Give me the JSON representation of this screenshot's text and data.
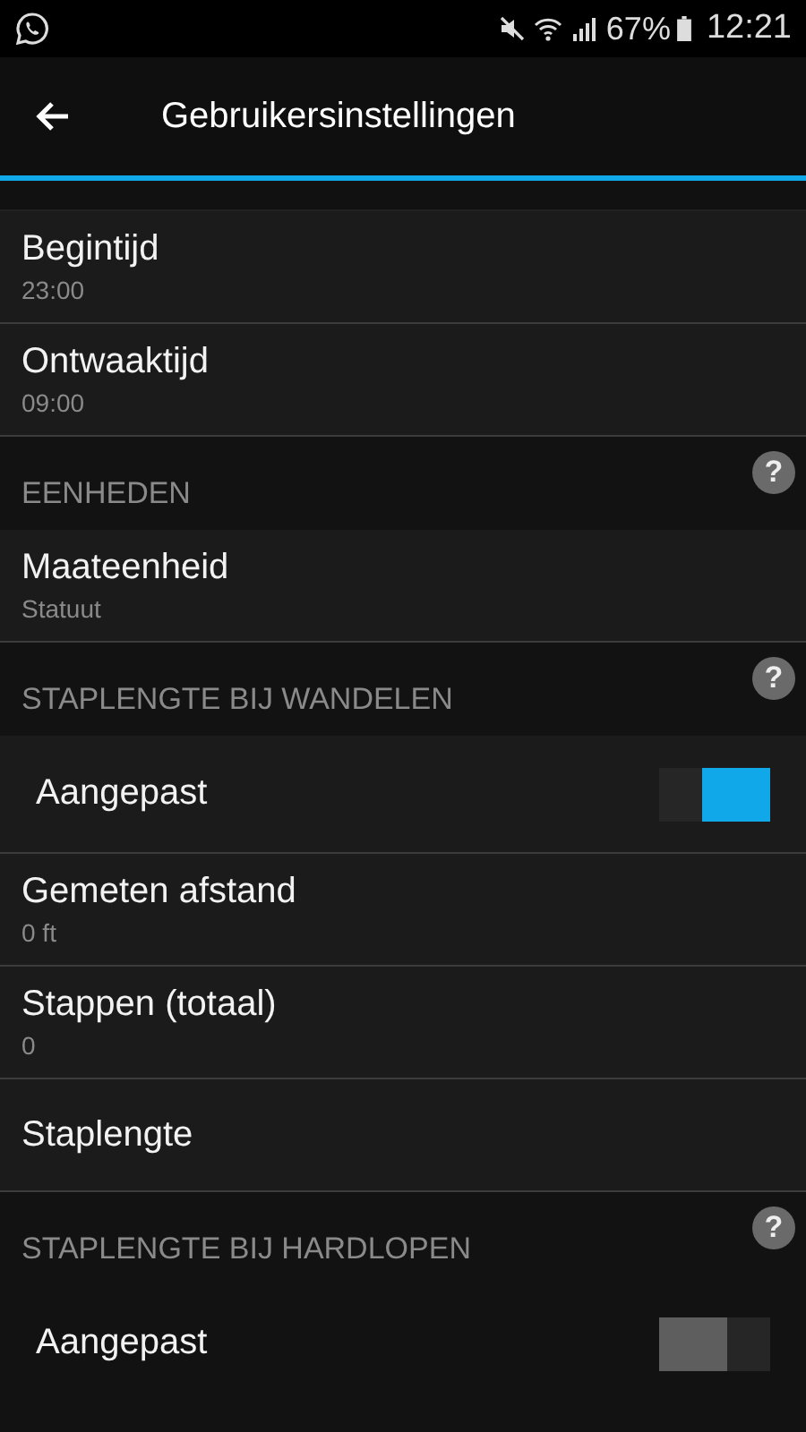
{
  "status_bar": {
    "battery": "67%",
    "time": "12:21"
  },
  "toolbar": {
    "title": "Gebruikersinstellingen"
  },
  "sections": [
    {
      "rows": [
        {
          "kind": "value",
          "title": "Begintijd",
          "value": "23:00"
        },
        {
          "kind": "value",
          "title": "Ontwaaktijd",
          "value": "09:00"
        }
      ]
    },
    {
      "header": "EENHEDEN",
      "help": "?",
      "rows": [
        {
          "kind": "value",
          "title": "Maateenheid",
          "value": "Statuut"
        }
      ]
    },
    {
      "header": "STAPLENGTE BIJ WANDELEN",
      "help": "?",
      "rows": [
        {
          "kind": "toggle",
          "title": "Aangepast",
          "on": true
        },
        {
          "kind": "value",
          "title": "Gemeten afstand",
          "value": "0 ft"
        },
        {
          "kind": "value",
          "title": "Stappen (totaal)",
          "value": "0"
        },
        {
          "kind": "plain",
          "title": "Staplengte"
        }
      ]
    },
    {
      "header": "STAPLENGTE BIJ HARDLOPEN",
      "help": "?",
      "rows": [
        {
          "kind": "toggle",
          "title": "Aangepast",
          "on": false
        }
      ]
    }
  ]
}
